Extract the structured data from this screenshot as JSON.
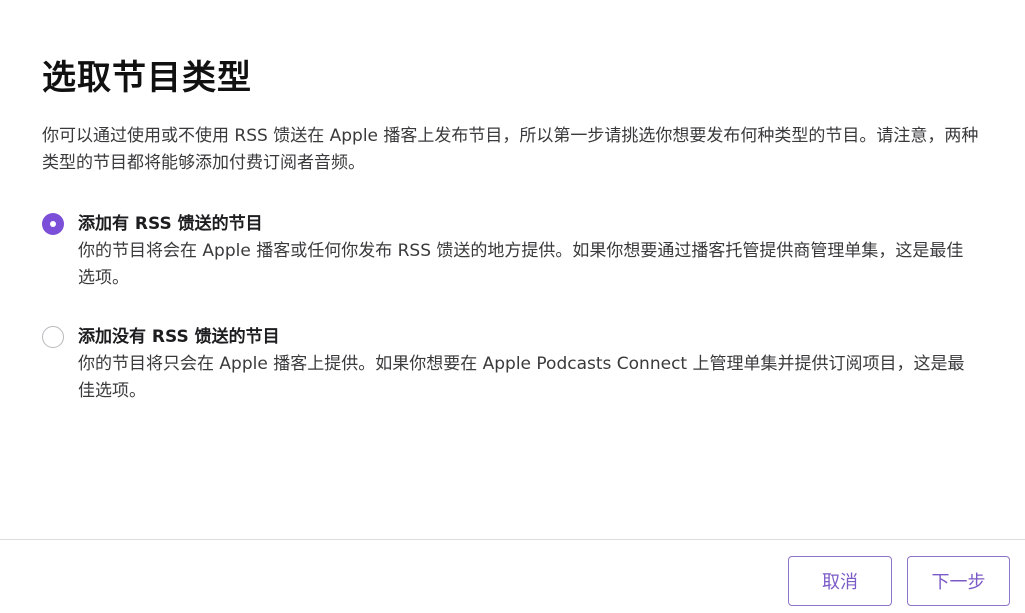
{
  "title": "选取节目类型",
  "intro": "你可以通过使用或不使用 RSS 馈送在 Apple 播客上发布节目，所以第一步请挑选你想要发布何种类型的节目。请注意，两种类型的节目都将能够添加付费订阅者音频。",
  "options": [
    {
      "label": "添加有 RSS 馈送的节目",
      "description": "你的节目将会在 Apple 播客或任何你发布 RSS 馈送的地方提供。如果你想要通过播客托管提供商管理单集，这是最佳选项。",
      "selected": true
    },
    {
      "label": "添加没有 RSS 馈送的节目",
      "description": "你的节目将只会在 Apple 播客上提供。如果你想要在 Apple Podcasts Connect 上管理单集并提供订阅项目，这是最佳选项。",
      "selected": false
    }
  ],
  "footer": {
    "cancel_label": "取消",
    "next_label": "下一步"
  },
  "colors": {
    "accent": "#7b4fd8",
    "button_text": "#7b5bc7",
    "button_border": "#8e74c9",
    "divider": "#dcdce0"
  }
}
